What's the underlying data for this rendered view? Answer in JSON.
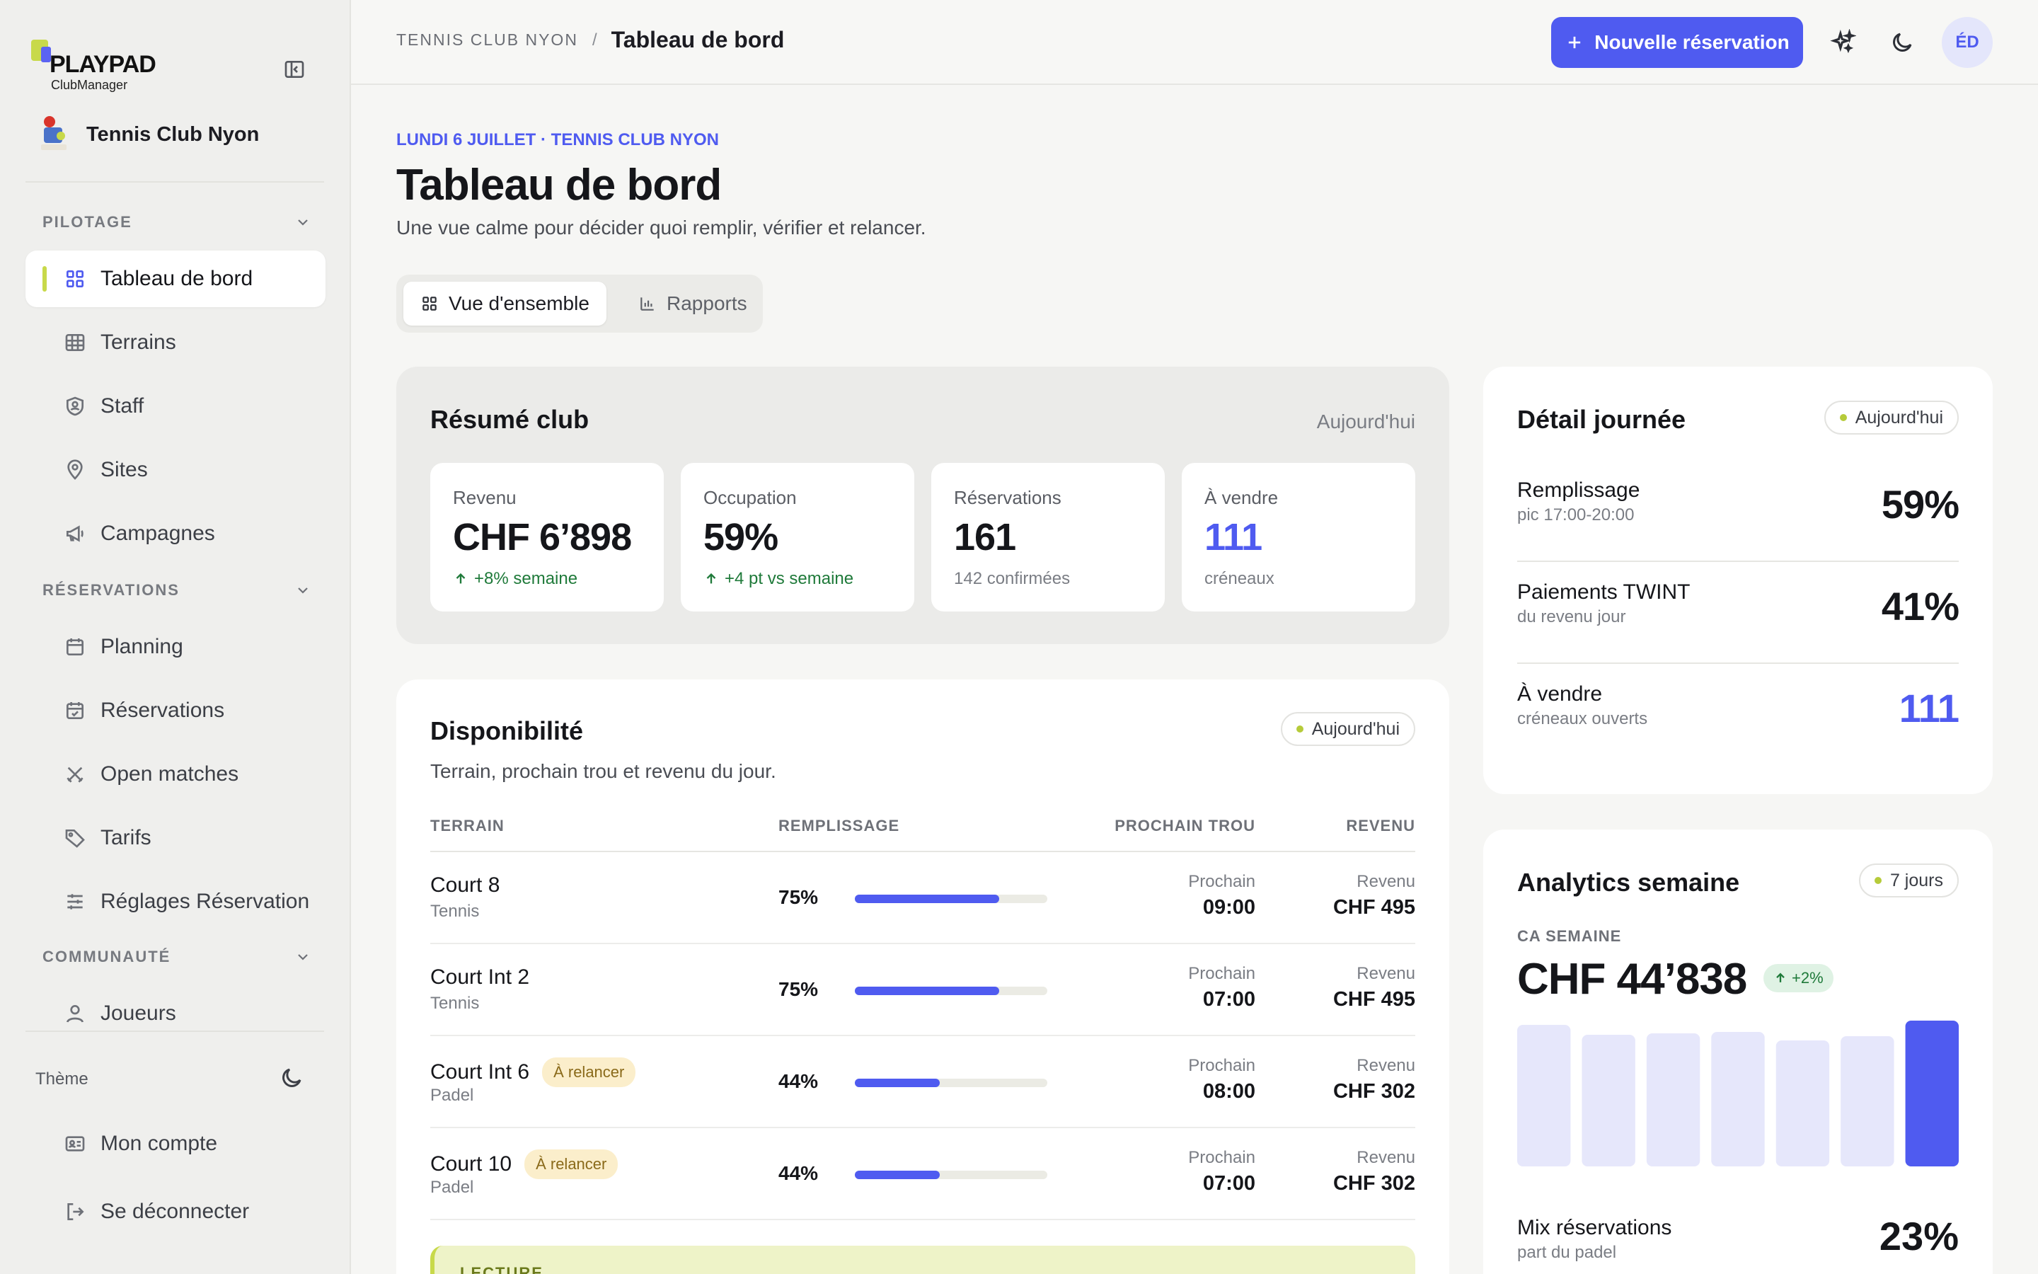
{
  "brand": {
    "logo_word": "PLAYPAD",
    "logo_sub": "ClubManager",
    "club_name": "Tennis Club Nyon"
  },
  "sidebar": {
    "sections": [
      {
        "label": "PILOTAGE"
      },
      {
        "label": "RÉSERVATIONS"
      },
      {
        "label": "COMMUNAUTÉ"
      }
    ],
    "items": [
      {
        "label": "Tableau de bord",
        "icon": "grid-icon",
        "active": true
      },
      {
        "label": "Terrains",
        "icon": "table-grid-icon"
      },
      {
        "label": "Staff",
        "icon": "shield-user-icon"
      },
      {
        "label": "Sites",
        "icon": "map-pin-icon"
      },
      {
        "label": "Campagnes",
        "icon": "megaphone-icon"
      },
      {
        "label": "Planning",
        "icon": "calendar-icon"
      },
      {
        "label": "Réservations",
        "icon": "calendar-check-icon"
      },
      {
        "label": "Open matches",
        "icon": "crossed-swords-icon"
      },
      {
        "label": "Tarifs",
        "icon": "tag-icon"
      },
      {
        "label": "Réglages Réservation",
        "icon": "sliders-icon"
      },
      {
        "label": "Joueurs",
        "icon": "user-icon"
      }
    ],
    "theme_label": "Thème",
    "account_items": [
      {
        "label": "Mon compte",
        "icon": "id-card-icon"
      },
      {
        "label": "Se déconnecter",
        "icon": "logout-icon"
      }
    ]
  },
  "topbar": {
    "crumb_club": "TENNIS CLUB NYON",
    "crumb_sep": "/",
    "crumb_page": "Tableau de bord",
    "new_button": "Nouvelle réservation",
    "avatar_initials": "ÉD"
  },
  "header": {
    "eyebrow": "LUNDI 6 JUILLET · TENNIS CLUB NYON",
    "title": "Tableau de bord",
    "subtitle": "Une vue calme pour décider quoi remplir, vérifier et relancer."
  },
  "tabs": [
    {
      "label": "Vue d'ensemble",
      "active": true
    },
    {
      "label": "Rapports",
      "active": false
    }
  ],
  "resume": {
    "title": "Résumé club",
    "meta": "Aujourd'hui",
    "kpis": [
      {
        "label": "Revenu",
        "value": "CHF 6’898",
        "note": "+8% semaine",
        "trend": "up"
      },
      {
        "label": "Occupation",
        "value": "59%",
        "note": "+4 pt vs semaine",
        "trend": "up"
      },
      {
        "label": "Réservations",
        "value": "161",
        "note": "142 confirmées",
        "trend": "none"
      },
      {
        "label": "À vendre",
        "value": "111",
        "note": "créneaux",
        "trend": "none",
        "accent": true
      }
    ]
  },
  "dispo": {
    "title": "Disponibilité",
    "pill": "Aujourd'hui",
    "subtitle": "Terrain, prochain trou et revenu du jour.",
    "columns": [
      "TERRAIN",
      "REMPLISSAGE",
      "PROCHAIN TROU",
      "REVENU"
    ],
    "rows": [
      {
        "name": "Court 8",
        "sport": "Tennis",
        "fill_label": "75%",
        "fill": 0.75,
        "next_label": "Prochain",
        "next": "09:00",
        "rev_label": "Revenu",
        "revenue": "CHF 495",
        "badge": ""
      },
      {
        "name": "Court Int 2",
        "sport": "Tennis",
        "fill_label": "75%",
        "fill": 0.75,
        "next_label": "Prochain",
        "next": "07:00",
        "rev_label": "Revenu",
        "revenue": "CHF 495",
        "badge": ""
      },
      {
        "name": "Court Int 6",
        "sport": "Padel",
        "fill_label": "44%",
        "fill": 0.44,
        "next_label": "Prochain",
        "next": "08:00",
        "rev_label": "Revenu",
        "revenue": "CHF 302",
        "badge": "À relancer"
      },
      {
        "name": "Court 10",
        "sport": "Padel",
        "fill_label": "44%",
        "fill": 0.44,
        "next_label": "Prochain",
        "next": "07:00",
        "rev_label": "Revenu",
        "revenue": "CHF 302",
        "badge": "À relancer"
      }
    ],
    "lecture_label": "LECTURE"
  },
  "detail": {
    "title": "Détail journée",
    "pill": "Aujourd'hui",
    "rows": [
      {
        "title": "Remplissage",
        "sub": "pic 17:00-20:00",
        "value": "59%",
        "accent": false
      },
      {
        "title": "Paiements TWINT",
        "sub": "du revenu jour",
        "value": "41%",
        "accent": false
      },
      {
        "title": "À vendre",
        "sub": "créneaux ouverts",
        "value": "111",
        "accent": true
      }
    ]
  },
  "analytics": {
    "title": "Analytics semaine",
    "pill": "7 jours",
    "ca_label": "CA SEMAINE",
    "ca_value": "CHF 44’838",
    "ca_delta": "+2%",
    "mix_title": "Mix réservations",
    "mix_sub": "part du padel",
    "mix_value": "23%"
  },
  "chart_data": {
    "type": "bar",
    "values": [
      1.0,
      0.93,
      0.94,
      0.95,
      0.89,
      0.92,
      1.03
    ],
    "highlight_index": 6,
    "colors": {
      "base": "#e6e7fb",
      "highlight": "#4f5bf0"
    }
  },
  "colors": {
    "accent": "#4f5bf0",
    "lime": "#c8d94a",
    "positive": "#1f7a3a"
  }
}
